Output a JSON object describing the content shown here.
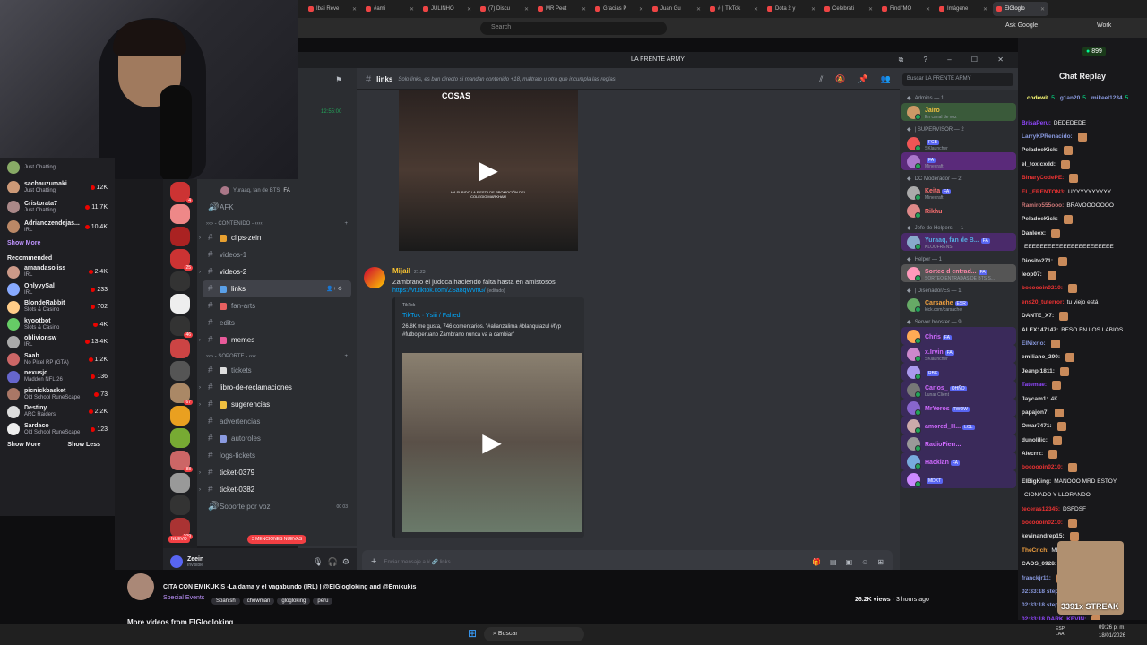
{
  "browser": {
    "tabs": [
      "Ibai Reve",
      "#ami",
      "JULINHO",
      "(7) Discu",
      "MR Peet",
      "Gracias P",
      "Juan Gu",
      "# | TikTok",
      "Dota 2 y",
      "Celebrati",
      "Find 'MO",
      "Imágene",
      "ElGloglo"
    ],
    "search_placeholder": "Search",
    "ask_google": "Ask Google",
    "work": "Work"
  },
  "twitch_nav": {
    "followed": [
      {
        "name": "",
        "game": "Just Chatting",
        "viewers": ""
      },
      {
        "name": "sachauzumaki",
        "game": "Just Chatting",
        "viewers": "12K"
      },
      {
        "name": "Cristorata7",
        "game": "Just Chatting",
        "viewers": "11.7K"
      },
      {
        "name": "Adrianozendejas...",
        "game": "IRL",
        "viewers": "10.4K"
      }
    ],
    "show_more": "Show More",
    "recommended_label": "Recommended",
    "recommended": [
      {
        "name": "amandasoliss",
        "game": "IRL",
        "viewers": "2.4K",
        "color": "#c98"
      },
      {
        "name": "OnlyyySal",
        "game": "IRL",
        "viewers": "233",
        "color": "#8af"
      },
      {
        "name": "BlondeRabbit",
        "game": "Slots & Casino",
        "viewers": "702",
        "color": "#fc8"
      },
      {
        "name": "kyootbot",
        "game": "Slots & Casino",
        "viewers": "4K",
        "color": "#6c6"
      },
      {
        "name": "oblivionsw",
        "game": "IRL",
        "viewers": "13.4K",
        "color": "#aaa"
      },
      {
        "name": "Saab",
        "game": "No Pixel RP (GTA)",
        "viewers": "1.2K",
        "color": "#c66"
      },
      {
        "name": "nexusjd",
        "game": "Madden NFL 26",
        "viewers": "136",
        "color": "#66c"
      },
      {
        "name": "picnickbasket",
        "game": "Old School RuneScape",
        "viewers": "73",
        "color": "#a76"
      },
      {
        "name": "Destiny",
        "game": "ARC Raiders",
        "viewers": "2.2K",
        "color": "#ddd"
      },
      {
        "name": "Sardaco",
        "game": "Old School RuneScape",
        "viewers": "123",
        "color": "#eee"
      }
    ],
    "show_more2": "Show More",
    "show_less": "Show Less"
  },
  "discord": {
    "server_name": "LA FRENTE ARMY",
    "time": "12:55:00",
    "channel": "links",
    "topic": "Solo links, es ban directo si mandan contenido +18, maltrato u otra que incumpla las reglas",
    "search_placeholder": "Buscar LA FRENTE ARMY",
    "voice_user": "Yuraaq, fan de BTS",
    "voice_tag": "FA",
    "channels": [
      {
        "type": "voice",
        "name": "AFK"
      },
      {
        "type": "cat",
        "name": "›››› - CONTENIDO - ‹‹‹‹"
      },
      {
        "type": "text",
        "name": "clips-zein",
        "bright": true,
        "emoji": "#e8a030"
      },
      {
        "type": "text",
        "name": "videos-1"
      },
      {
        "type": "text",
        "name": "videos-2",
        "bright": true
      },
      {
        "type": "text",
        "name": "links",
        "selected": true,
        "emoji": "#5aa0e8"
      },
      {
        "type": "text",
        "name": "fan-arts",
        "emoji": "#e86060"
      },
      {
        "type": "text",
        "name": "edits"
      },
      {
        "type": "text",
        "name": "memes",
        "bright": true,
        "emoji": "#e85a9a"
      },
      {
        "type": "cat",
        "name": "›››› - SOPORTE - ‹‹‹‹"
      },
      {
        "type": "text",
        "name": "tickets",
        "emoji": "#ddd"
      },
      {
        "type": "text",
        "name": "libro-de-reclamaciones",
        "bright": true
      },
      {
        "type": "text",
        "name": "sugerencias",
        "bright": true,
        "emoji": "#f0c040"
      },
      {
        "type": "text",
        "name": "advertencias"
      },
      {
        "type": "text",
        "name": "autoroles",
        "emoji": "#8a9ae0"
      },
      {
        "type": "text",
        "name": "logs-tickets"
      },
      {
        "type": "text",
        "name": "ticket-0379",
        "bright": true
      },
      {
        "type": "text",
        "name": "ticket-0382",
        "bright": true
      },
      {
        "type": "voice",
        "name": "Soporte por voz",
        "count": "00 03"
      }
    ],
    "new_badge": "NUEVO",
    "mentions_badge": "3 MENCIONES NUEVAS",
    "user": {
      "name": "Zeein",
      "status": "Invisible"
    },
    "video1_caption": "COSAS",
    "video1_text": "HA SUBIDO LA FIESTA DE PROMOCIÓN DEL COLEGIO MARKHAM",
    "message": {
      "author": "Mijail",
      "time": "21:23",
      "text": "Zambrano el judoca haciendo falta hasta en amistosos",
      "link": "https://vt.tiktok.com/ZSa8qWvnG/",
      "edited": "(editado)",
      "embed_provider": "TikTok",
      "embed_title": "TikTok · Ysiii / Fahed",
      "embed_desc": "26.8K me gusta, 746 comentarios. \"#alianzalima #blanquiazul #fyp #futbolperuano Zambrano nunca va a cambiar\""
    },
    "composer_placeholder": "Enviar mensaje a # 🔗 links",
    "members": [
      {
        "role": "Admins — 1"
      },
      {
        "name": "Jairo",
        "sub": "En canal de voz",
        "color": "#f0c040",
        "hl": "#3a5a3a"
      },
      {
        "role": "| SUPERVISOR — 2"
      },
      {
        "name": "",
        "sub": "SKlauncher",
        "color": "#e33",
        "tag": "FCB"
      },
      {
        "name": "",
        "sub": "Minecraft",
        "color": "#c066ff",
        "tag": "FA",
        "hl": "#5a2a7a"
      },
      {
        "role": "DC Moderador — 2"
      },
      {
        "name": "Keita",
        "sub": "Minecraft",
        "color": "#ff7070",
        "tag": "FA"
      },
      {
        "name": "Rikhu",
        "sub": "",
        "color": "#ff7070"
      },
      {
        "role": "Jefe de Helpers — 1"
      },
      {
        "name": "Yuraaq, fan de B...",
        "sub": "KLOUFRENS",
        "color": "#5ad",
        "tag": "FA",
        "hl": "#4a2a6a"
      },
      {
        "role": "Helper — 1"
      },
      {
        "name": "Sorteo d entrad...",
        "sub": "SORTEO ENTRADAS DE BTS S...",
        "color": "#f8a",
        "tag": "FA",
        "hl": "#555"
      },
      {
        "role": "| Diseñador/Es — 1"
      },
      {
        "name": "Carsache",
        "sub": "kick.com/carsache",
        "color": "#f0a040",
        "tag": "ESR"
      },
      {
        "role": "Server booster — 9"
      },
      {
        "name": "Chris",
        "sub": "",
        "color": "#d06aff",
        "tag": "FA",
        "hl": "#3a2a5a"
      },
      {
        "name": "x.Irvin",
        "sub": "SKlauncher",
        "color": "#d06aff",
        "tag": "FA",
        "hl": "#3a2a5a"
      },
      {
        "name": "",
        "sub": "",
        "color": "#d06aff",
        "tag": "RBE",
        "hl": "#3a2a5a"
      },
      {
        "name": "Carlos_",
        "sub": "Lunar Client",
        "color": "#d06aff",
        "tag": "OHÑO",
        "hl": "#3a2a5a"
      },
      {
        "name": "MrYeros",
        "sub": "",
        "color": "#d06aff",
        "tag": "TWOW",
        "hl": "#3a2a5a"
      },
      {
        "name": "amored_H...",
        "sub": "",
        "color": "#d06aff",
        "tag": "LOL",
        "hl": "#3a2a5a"
      },
      {
        "name": "RadioFierr...",
        "sub": "",
        "color": "#d06aff",
        "hl": "#3a2a5a"
      },
      {
        "name": "Hacklan",
        "sub": "",
        "color": "#d06aff",
        "tag": "FA",
        "hl": "#3a2a5a"
      },
      {
        "name": "",
        "sub": "",
        "color": "#d06aff",
        "tag": "MDKT",
        "hl": "#3a2a5a"
      }
    ]
  },
  "twitch_chat": {
    "title": "Chat Replay",
    "points": "899",
    "gifters": [
      {
        "name": "codewit",
        "n": "5"
      },
      {
        "name": "g1an20",
        "n": "5"
      },
      {
        "name": "mikeel1234",
        "n": "5"
      }
    ],
    "lines": [
      {
        "u": "BrisaPeru:",
        "c": "#9147ff",
        "t": "DEDEDEDE"
      },
      {
        "u": "LarryKPRenacido:",
        "c": "#8a9ae0",
        "t": ""
      },
      {
        "u": "PeladoeKick:",
        "c": "#ddd",
        "t": ""
      },
      {
        "u": "el_toxicxdd:",
        "c": "#ddd",
        "t": ""
      },
      {
        "u": "BinaryCodePE:",
        "c": "#e33",
        "t": ""
      },
      {
        "u": "EL_FRENTON3:",
        "c": "#e33",
        "t": "UYYYYYYYYYY"
      },
      {
        "u": "Ramiro555ooo:",
        "c": "#c77",
        "t": "BRAVOOOOOOO"
      },
      {
        "u": "PeladoeKick:",
        "c": "#ddd",
        "t": ""
      },
      {
        "u": "Danleex:",
        "c": "#ddd",
        "t": ""
      },
      {
        "u": "",
        "c": "#ddd",
        "t": "EEEEEEEEEEEEEEEEEEEEEEE"
      },
      {
        "u": "Diosito271:",
        "c": "#ddd",
        "t": ""
      },
      {
        "u": "leop07:",
        "c": "#ddd",
        "t": ""
      },
      {
        "u": "bocoooin0210:",
        "c": "#e33",
        "t": ""
      },
      {
        "u": "ens20_tuterror:",
        "c": "#e33",
        "t": "tu viejo está"
      },
      {
        "u": "DANTE_X7:",
        "c": "#ddd",
        "t": ""
      },
      {
        "u": "ALEX147147:",
        "c": "#ddd",
        "t": "BESO EN LOS LABIOS"
      },
      {
        "u": "ElNixrio:",
        "c": "#8a9ae0",
        "t": ""
      },
      {
        "u": "emiliano_290:",
        "c": "#ddd",
        "t": ""
      },
      {
        "u": "Jeanpi1811:",
        "c": "#ddd",
        "t": ""
      },
      {
        "u": "Tatemae:",
        "c": "#9147ff",
        "t": ""
      },
      {
        "u": "Jaycam1:",
        "c": "#ddd",
        "t": "4K"
      },
      {
        "u": "papajon7:",
        "c": "#ddd",
        "t": ""
      },
      {
        "u": "Omar7471:",
        "c": "#ddd",
        "t": ""
      },
      {
        "u": "dunolilic:",
        "c": "#ddd",
        "t": ""
      },
      {
        "u": "Alecrrz:",
        "c": "#ddd",
        "t": ""
      },
      {
        "u": "bocoooin0210:",
        "c": "#e33",
        "t": ""
      },
      {
        "u": "ElBigKing:",
        "c": "#ddd",
        "t": "MANOOO MRD ESTOY"
      },
      {
        "u": "",
        "c": "#ddd",
        "t": "CIONADO Y LLORANDO"
      },
      {
        "u": "teceras12345:",
        "c": "#e33",
        "t": "DSFDSF"
      },
      {
        "u": "bocoooin0210:",
        "c": "#e33",
        "t": ""
      },
      {
        "u": "kevinandrep15:",
        "c": "#ddd",
        "t": ""
      },
      {
        "u": "TheCrich:",
        "c": "#f0a040",
        "t": "ME ESTAN ... MACHITO"
      },
      {
        "u": "CAOS_0928:",
        "c": "#ddd",
        "t": ""
      },
      {
        "u": "franckjr11:",
        "c": "#8a9ae0",
        "t": ""
      },
      {
        "u": "02:33:18 stephanoo_7:",
        "c": "#8a9ae0",
        "t": ""
      },
      {
        "u": "02:33:18 stephanoo_7:",
        "c": "#8a9ae0",
        "t": ""
      },
      {
        "u": "02:33:18 DARK_KEVIN:",
        "c": "#9147ff",
        "t": ""
      }
    ],
    "streak": "3391x STREAK"
  },
  "stream_info": {
    "title": "CITA CON EMIKUKIS -La dama y el vagabundo (IRL) | @ElGlogloking and @Emikukis",
    "category": "Special Events",
    "tags": [
      "Spanish",
      "chowman",
      "glogloking",
      "peru"
    ],
    "views": "26.2K views",
    "ago": "3 hours ago",
    "more": "More videos from ElGlogloking"
  },
  "taskbar": {
    "search": "Buscar",
    "lang": "ESP LAA",
    "time": "09:26 p. m.",
    "date": "18/01/2026"
  }
}
